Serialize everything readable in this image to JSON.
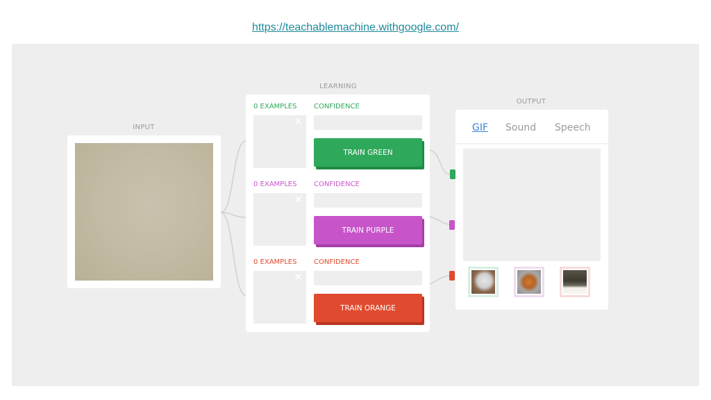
{
  "url": "https://teachablemachine.withgoogle.com/",
  "sections": {
    "input": "INPUT",
    "learning": "LEARNING",
    "output": "OUTPUT"
  },
  "classes": [
    {
      "examples": "0 EXAMPLES",
      "confidence": "CONFIDENCE",
      "button": "TRAIN GREEN",
      "color": "#2ea85a",
      "shade": "#1f8a45",
      "close_icon": "close-icon"
    },
    {
      "examples": "0 EXAMPLES",
      "confidence": "CONFIDENCE",
      "button": "TRAIN PURPLE",
      "color": "#c755c9",
      "shade": "#a53fa7",
      "close_icon": "close-icon"
    },
    {
      "examples": "0 EXAMPLES",
      "confidence": "CONFIDENCE",
      "button": "TRAIN ORANGE",
      "color": "#e04a2e",
      "shade": "#b83620",
      "close_icon": "close-icon"
    }
  ],
  "output": {
    "tabs": [
      {
        "label": "GIF",
        "active": true
      },
      {
        "label": "Sound",
        "active": false
      },
      {
        "label": "Speech",
        "active": false
      }
    ],
    "thumbnails": [
      {
        "subject": "white dog",
        "border": "#d7efe0"
      },
      {
        "subject": "orange dog",
        "border": "#efdcf0"
      },
      {
        "subject": "dark cat",
        "border": "#f6dada"
      }
    ]
  },
  "close_glyph": "✕"
}
